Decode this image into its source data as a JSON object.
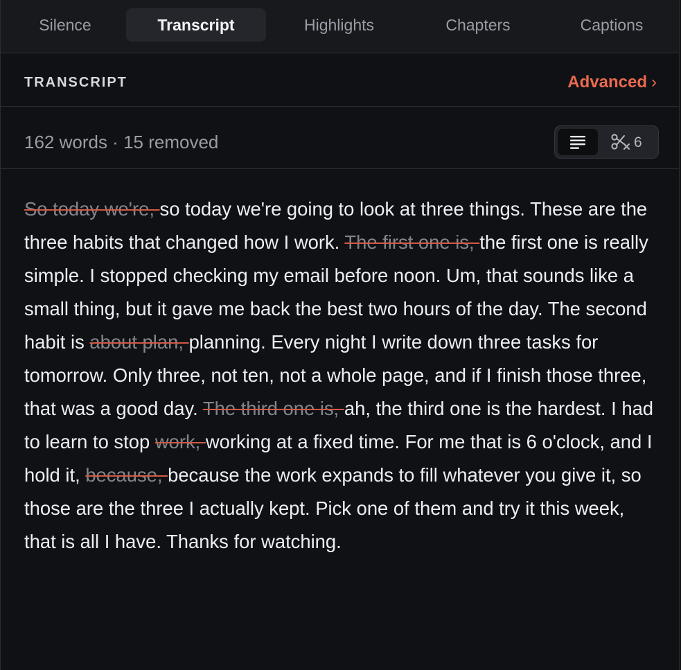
{
  "tabs": [
    {
      "label": "Silence",
      "active": false
    },
    {
      "label": "Transcript",
      "active": true
    },
    {
      "label": "Highlights",
      "active": false
    },
    {
      "label": "Chapters",
      "active": false
    },
    {
      "label": "Captions",
      "active": false
    }
  ],
  "section": {
    "title": "TRANSCRIPT",
    "advanced_label": "Advanced",
    "advanced_chevron": "›"
  },
  "stats": {
    "text": "162 words · 15 removed",
    "cuts_count": "6"
  },
  "icons": {
    "text_view": "lines-icon",
    "cuts_view": "scissors-x-icon"
  },
  "colors": {
    "accent": "#ea6a4f",
    "strike": "#d05a45",
    "background": "#101114"
  },
  "transcript": {
    "segments": [
      {
        "text": "So today we're, ",
        "removed": true
      },
      {
        "text": "so today we're going to look at three things. These are the three habits that changed how I work. ",
        "removed": false
      },
      {
        "text": "The first one is, ",
        "removed": true
      },
      {
        "text": "the first one is really simple. I stopped checking my email before noon. Um, that sounds like a small thing, but it gave me back the best two hours of the day. The second habit is ",
        "removed": false
      },
      {
        "text": "about plan, ",
        "removed": true
      },
      {
        "text": "planning. Every night I write down three tasks for tomorrow. Only three, not ten, not a whole page, and if I finish those three, that was a good day. ",
        "removed": false
      },
      {
        "text": "The third one is, ",
        "removed": true
      },
      {
        "text": "ah, the third one is the hardest. I had to learn to stop ",
        "removed": false
      },
      {
        "text": "work, ",
        "removed": true
      },
      {
        "text": "working at a fixed time. For me that is 6 o'clock, and I hold it, ",
        "removed": false
      },
      {
        "text": "because, ",
        "removed": true
      },
      {
        "text": "because the work expands to fill whatever you give it, so those are the three I actually kept. Pick one of them and try it this week, that is all I have. Thanks for watching.",
        "removed": false
      }
    ]
  }
}
